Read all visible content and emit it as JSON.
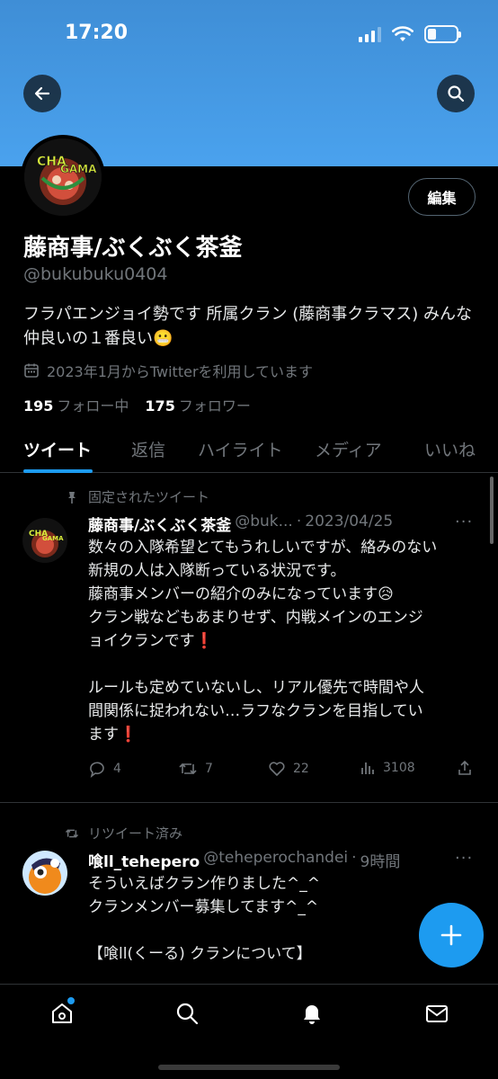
{
  "status": {
    "time": "17:20"
  },
  "profile": {
    "display_name": "藤商事/ぶくぶく茶釜",
    "handle": "@bukubuku0404",
    "edit_label": "編集",
    "bio": "フラパエンジョイ勢です 所属クラン (藤商事クラマス) みんな仲良いの１番良い😬",
    "joined": "2023年1月からTwitterを利用しています",
    "following_count": "195",
    "following_label": "フォロー中",
    "followers_count": "175",
    "followers_label": "フォロワー",
    "avatar_text": "CHA GAMA"
  },
  "tabs": [
    "ツイート",
    "返信",
    "ハイライト",
    "メディア",
    "いいね"
  ],
  "tweets": [
    {
      "context": "固定されたツイート",
      "name": "藤商事/ぶくぶく茶釜",
      "handle": "@buk...",
      "dot": "·",
      "date": "2023/04/25",
      "more": "···",
      "lines": [
        "数々の入隊希望とてもうれしいですが、絡みのない",
        "新規の人は入隊断っている状況です。",
        "藤商事メンバーの紹介のみになっています😥",
        "クラン戦などもあまりせず、内戦メインのエンジ",
        "ョイクランです❗️",
        "",
        "ルールも定めていないし、リアル優先で時間や人",
        "間関係に捉われない…ラフなクランを目指してい",
        "ます❗️"
      ],
      "replies": "4",
      "retweets": "7",
      "likes": "22",
      "views": "3108"
    },
    {
      "context": "リツイート済み",
      "name": "喰ll_tehepero",
      "handle": "@teheperochandei",
      "dot": "·",
      "date": "9時間",
      "more": "···",
      "lines": [
        "そういえばクラン作りました^_^",
        "クランメンバー募集してます^_^",
        "",
        "【喰ll(くーる) クランについて】"
      ]
    }
  ],
  "icons": {
    "back": "arrow-left-icon",
    "search": "search-icon",
    "fab": "plus-icon",
    "nav": [
      "home-icon",
      "search-icon",
      "bell-icon",
      "mail-icon"
    ]
  },
  "colors": {
    "accent": "#1d9bf0",
    "banner": "#4aa2ee",
    "muted": "#71767b"
  }
}
